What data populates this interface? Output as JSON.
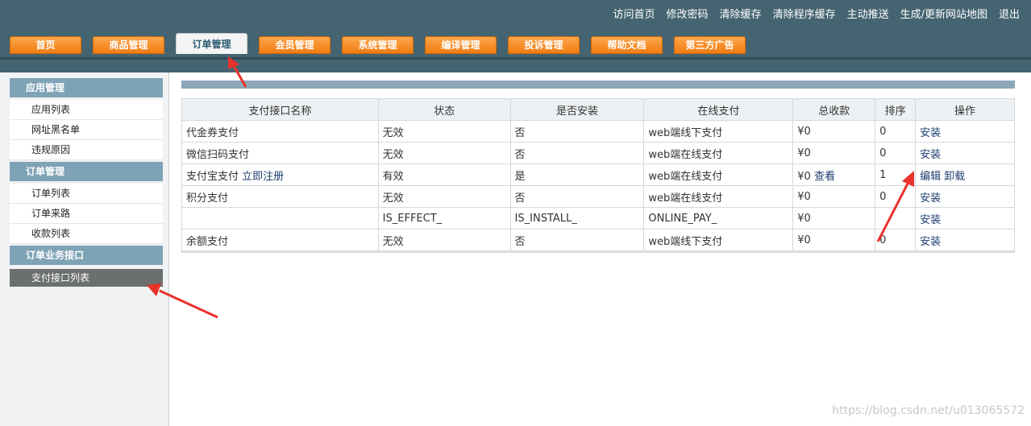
{
  "header": {
    "top_links": [
      "访问首页",
      "修改密码",
      "清除缓存",
      "清除程序缓存",
      "主动推送",
      "生成/更新网站地图",
      "退出"
    ],
    "tabs": [
      "首页",
      "商品管理",
      "订单管理",
      "会员管理",
      "系统管理",
      "编译管理",
      "投诉管理",
      "帮助文档",
      "第三方广告"
    ],
    "active_tab": "订单管理"
  },
  "sidebar": {
    "sections": [
      {
        "title": "应用管理",
        "items": [
          "应用列表",
          "网址黑名单",
          "违规原因"
        ]
      },
      {
        "title": "订单管理",
        "items": [
          "订单列表",
          "订单来路",
          "收款列表"
        ]
      },
      {
        "title": "订单业务接口",
        "items": [
          "支付接口列表"
        ]
      }
    ],
    "active_item": "支付接口列表"
  },
  "table": {
    "columns": [
      "支付接口名称",
      "状态",
      "是否安装",
      "在线支付",
      "总收款",
      "排序",
      "操作"
    ],
    "rows": [
      {
        "name": "代金券支付",
        "name_link": "",
        "status": "无效",
        "installed": "否",
        "online": "web端线下支付",
        "total": "¥0",
        "total_link": "",
        "order": "0",
        "actions": [
          "安装"
        ]
      },
      {
        "name": "微信扫码支付",
        "name_link": "",
        "status": "无效",
        "installed": "否",
        "online": "web端在线支付",
        "total": "¥0",
        "total_link": "",
        "order": "0",
        "actions": [
          "安装"
        ]
      },
      {
        "name": "支付宝支付",
        "name_link": "立即注册",
        "status": "有效",
        "installed": "是",
        "online": "web端在线支付",
        "total": "¥0",
        "total_link": "查看",
        "order": "1",
        "actions": [
          "编辑",
          "卸载"
        ]
      },
      {
        "name": "积分支付",
        "name_link": "",
        "status": "无效",
        "installed": "否",
        "online": "web端在线支付",
        "total": "¥0",
        "total_link": "",
        "order": "0",
        "actions": [
          "安装"
        ]
      },
      {
        "name": "",
        "name_link": "",
        "status": "IS_EFFECT_",
        "installed": "IS_INSTALL_",
        "online": "ONLINE_PAY_",
        "total": "¥0",
        "total_link": "",
        "order": "",
        "actions": [
          "安装"
        ]
      },
      {
        "name": "余额支付",
        "name_link": "",
        "status": "无效",
        "installed": "否",
        "online": "web端线下支付",
        "total": "¥0",
        "total_link": "",
        "order": "0",
        "actions": [
          "安装"
        ]
      }
    ]
  },
  "watermark": "https://blog.csdn.net/u013065572",
  "colors": {
    "header": "#456471",
    "tab_orange": "#f07c12",
    "section_title": "#7fa3b6",
    "active_item": "#6b6f6d",
    "arrow": "#e8322a"
  }
}
